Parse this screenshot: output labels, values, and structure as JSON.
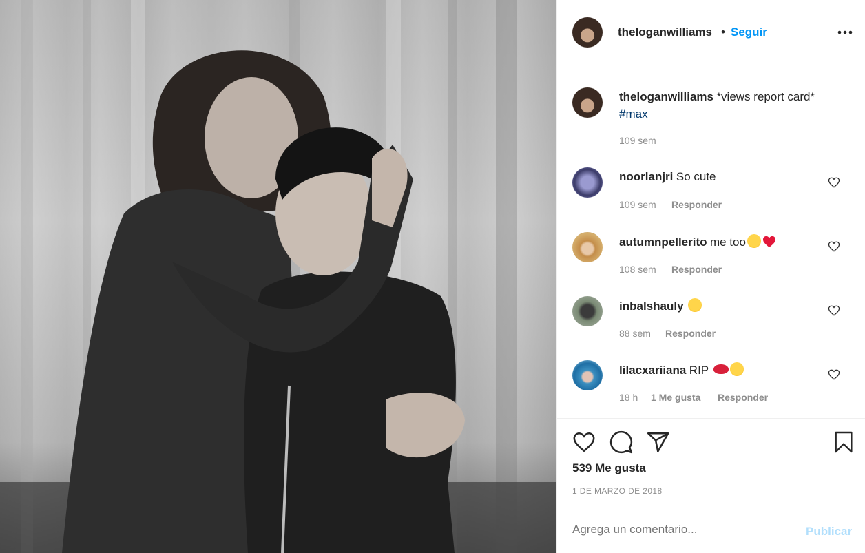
{
  "header": {
    "username": "theloganwilliams",
    "separator": "•",
    "follow_label": "Seguir",
    "more_icon": "more-horizontal-icon"
  },
  "caption": {
    "username": "theloganwilliams",
    "text": "*views report card*",
    "hashtag": "#max",
    "time": "109 sem"
  },
  "comments": [
    {
      "username": "noorlanjri",
      "text": "So cute",
      "emojis": [],
      "time": "109 sem",
      "likes": "",
      "reply": "Responder"
    },
    {
      "username": "autumnpellerito",
      "text": "me too",
      "emojis": [
        "laughing-tears-emoji",
        "red-heart-emoji"
      ],
      "time": "108 sem",
      "likes": "",
      "reply": "Responder"
    },
    {
      "username": "inbalshauly",
      "text": "",
      "emojis": [
        "smirk-emoji"
      ],
      "time": "88 sem",
      "likes": "",
      "reply": "Responder"
    },
    {
      "username": "lilacxariiana",
      "text": "RIP",
      "emojis": [
        "lips-emoji",
        "face-with-hand-emoji"
      ],
      "time": "18 h",
      "likes": "1 Me gusta",
      "reply": "Responder"
    }
  ],
  "actions": {
    "like_icon": "heart-icon",
    "comment_icon": "comment-icon",
    "share_icon": "paper-plane-icon",
    "save_icon": "bookmark-icon"
  },
  "likes": "539 Me gusta",
  "date": "1 DE MARZO DE 2018",
  "add_comment": {
    "placeholder": "Agrega un comentario...",
    "publish_label": "Publicar"
  },
  "colors": {
    "link": "#0095f6",
    "hashtag": "#00376b",
    "muted": "#8e8e8e",
    "publish_disabled": "#b2dffc",
    "text": "#262626",
    "border": "#efefef"
  }
}
